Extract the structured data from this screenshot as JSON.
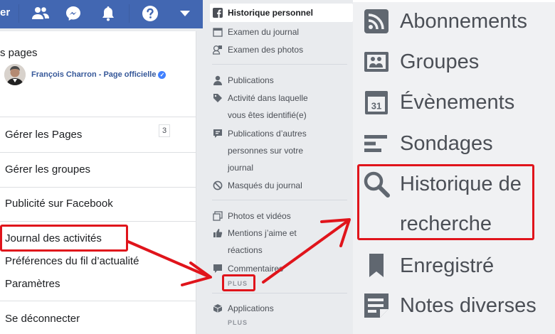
{
  "fb_menu": {
    "brand_fragment": "er",
    "section_title": "s pages",
    "page_name": "François Charron - Page officielle",
    "page_count": "3",
    "items": [
      "Gérer les Pages",
      "Gérer les groupes",
      "Publicité sur Facebook",
      "Journal des activités",
      "Préférences du fil d’actualité",
      "Paramètres",
      "Se déconnecter"
    ]
  },
  "activity_sidebar": {
    "items": {
      "historique": "Historique personnel",
      "examen_journal": "Examen du journal",
      "examen_photos": "Examen des photos",
      "publications": "Publications",
      "identifie_1": "Activité dans laquelle",
      "identifie_2": "vous êtes identifié(e)",
      "autres_1": "Publications d’autres",
      "autres_2": "personnes sur votre",
      "autres_3": "journal",
      "masques": "Masqués du journal",
      "photos": "Photos et vidéos",
      "mentions_1": "Mentions j’aime et",
      "mentions_2": "réactions",
      "commentaires": "Commentaires",
      "plus_1": "PLUS",
      "applications": "Applications",
      "plus_2": "PLUS"
    }
  },
  "big_menu": {
    "items": {
      "abonnements": "Abonnements",
      "groupes": "Groupes",
      "evenements": "Évènements",
      "calendar_day": "31",
      "sondages": "Sondages",
      "historique_1": "Historique de",
      "historique_2": "recherche",
      "enregistre": "Enregistré",
      "notes": "Notes diverses"
    }
  },
  "colors": {
    "facebook_blue": "#4267b2",
    "annotation_red": "#e0141b",
    "icon_gray": "#606770"
  }
}
